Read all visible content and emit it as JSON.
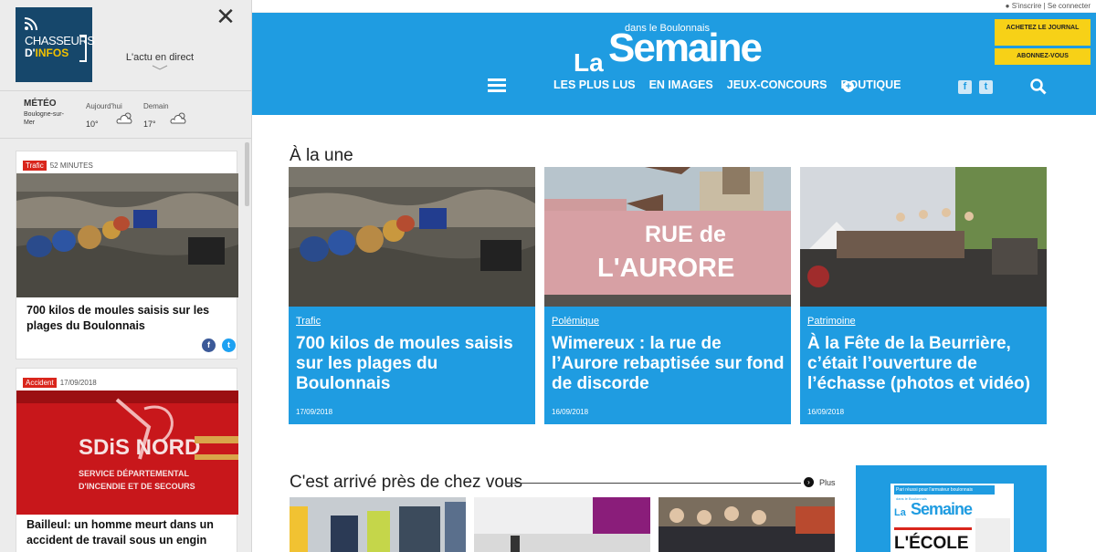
{
  "sidebar": {
    "logo_line1": "CHASSEURS",
    "logo_line2a": "D'",
    "logo_line2b": "INFOS",
    "close": "✕",
    "live_label": "L'actu en direct",
    "meteo": {
      "title": "MÉTÉO",
      "city": "Boulogne-sur-Mer",
      "today_label": "Aujourd'hui",
      "today_temp": "10°",
      "tomorrow_label": "Demain",
      "tomorrow_temp": "17°",
      "weather_icon": "partly-cloudy-icon"
    },
    "feed": [
      {
        "tag": "Trafic",
        "time": "52 MINUTES",
        "title": "700 kilos de moules saisis sur les plages du Boulonnais"
      },
      {
        "tag": "Accident",
        "time": "17/09/2018",
        "title": "Bailleul: un homme meurt dans un accident de travail sous un engin"
      }
    ],
    "social": {
      "facebook": "f",
      "twitter": "t"
    }
  },
  "header": {
    "account": "S'inscrire | Se connecter",
    "brand_sub": "dans le Boulonnais",
    "brand_la": "La",
    "brand_main": "Semaine",
    "cta_buy": "ACHETEZ LE JOURNAL",
    "cta_subscribe": "ABONNEZ-VOUS",
    "nav": [
      "LES PLUS LUS",
      "EN IMAGES",
      "JEUX-CONCOURS",
      "BOUTIQUE"
    ],
    "plus": "+",
    "facebook": "f",
    "twitter": "t",
    "colors": {
      "brand_blue": "#1f9ce1",
      "cta_yellow": "#f7d117",
      "tag_red": "#d9261c"
    }
  },
  "main": {
    "une_title": "À la une",
    "une": [
      {
        "category": "Trafic",
        "title": "700 kilos de moules saisis sur les plages du Boulonnais",
        "date": "17/09/2018"
      },
      {
        "category": "Polémique",
        "title": "Wimereux : la rue de l’Aurore rebaptisée sur fond de discorde",
        "date": "16/09/2018"
      },
      {
        "category": "Patrimoine",
        "title": "À la Fête de la Beurrière, c’était l’ouverture de l’échasse (photos et vidéo)",
        "date": "16/09/2018"
      }
    ],
    "near_title": "C'est arrivé près de chez vous",
    "more": "Plus",
    "more_icon": "arrow-right-icon",
    "graffiti_text_1": "RUE de",
    "graffiti_text_2": "L'AURORE",
    "sdis_text": "SDiS NORD",
    "sdis_sub_1": "SERVICE DÉPARTEMENTAL",
    "sdis_sub_2": "D'INCENDIE ET DE SECOURS"
  },
  "magazine": {
    "headline_top": "Pari réussi pour l'armateur boulonnais",
    "brand_sub": "dans le Boulonnais",
    "brand_la": "La",
    "brand_main": "Semaine",
    "cover_title": "L'ÉCOLE"
  }
}
